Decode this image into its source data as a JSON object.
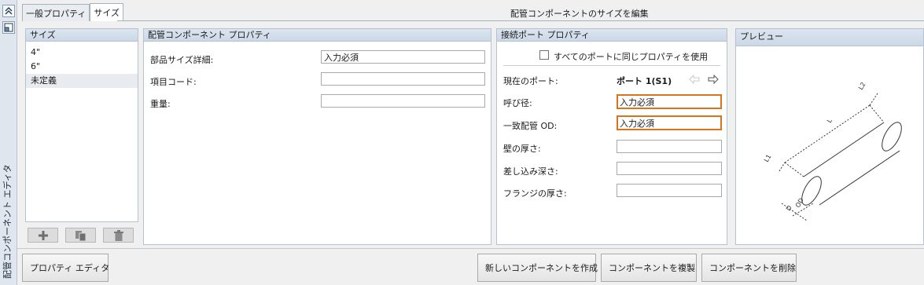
{
  "vertical_title": "配管コンポーネント エディタ",
  "tabs": [
    "一般プロパティ",
    "サイズ"
  ],
  "header": {
    "title": "配管コンポーネントのサイズを編集"
  },
  "sizes": {
    "title": "サイズ",
    "items": [
      "4\"",
      "6\"",
      "未定義"
    ]
  },
  "component_props": {
    "title": "配管コンポーネント プロパティ",
    "part_size_label": "部品サイズ詳細:",
    "part_size_value": "入力必須",
    "item_code_label": "項目コード:",
    "item_code_value": "",
    "weight_label": "重量:",
    "weight_value": ""
  },
  "port_props": {
    "title": "接続ポート プロパティ",
    "same_props_label": "すべてのポートに同じプロパティを使用",
    "current_port_label": "現在のポート:",
    "current_port_value": "ポート 1(S1)",
    "nominal_label": "呼び径:",
    "nominal_value": "入力必須",
    "matching_od_label": "一致配管 OD:",
    "matching_od_value": "入力必須",
    "wall_label": "壁の厚さ:",
    "wall_value": "",
    "engagement_label": "差し込み深さ:",
    "engagement_value": "",
    "flange_label": "フランジの厚さ:",
    "flange_value": ""
  },
  "preview": {
    "title": "プレビュー",
    "dim_labels": {
      "l2": "L2",
      "l": "L",
      "l1": "L1",
      "d": "D",
      "od": "OD"
    }
  },
  "bottom": {
    "property_editor": "プロパティ エディタ",
    "new_component": "新しいコンポーネントを作成",
    "duplicate_component": "コンポーネントを複製",
    "delete_component": "コンポーネントを削除"
  },
  "colors": {
    "required_border": "#d9731c",
    "panel_header": "#cbd8e6"
  }
}
